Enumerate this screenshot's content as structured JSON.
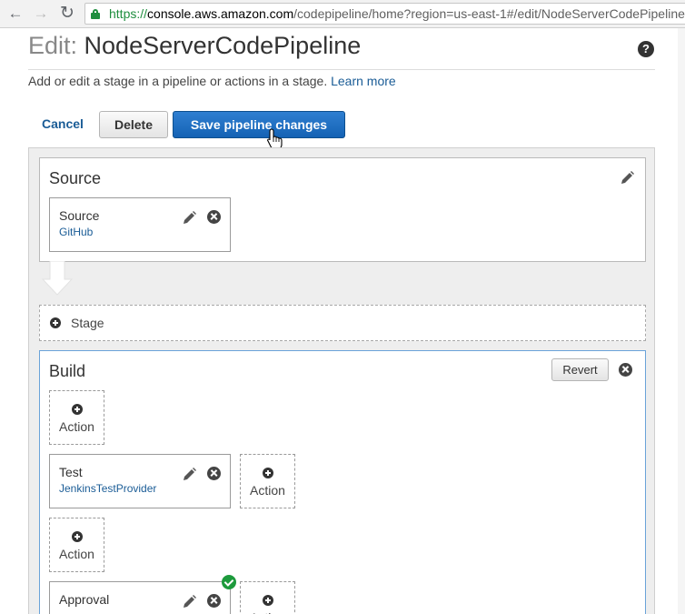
{
  "browser": {
    "url_protocol": "https://",
    "url_host": "console.aws.amazon.com",
    "url_path": "/codepipeline/home?region=us-east-1#/edit/NodeServerCodePipeline"
  },
  "header": {
    "title_prefix": "Edit:",
    "title_name": "NodeServerCodePipeline",
    "subtitle": "Add or edit a stage in a pipeline or actions in a stage.",
    "learn_more": "Learn more"
  },
  "toolbar": {
    "cancel_label": "Cancel",
    "delete_label": "Delete",
    "save_label": "Save pipeline changes"
  },
  "stages": {
    "source": {
      "name": "Source",
      "actions": [
        {
          "name": "Source",
          "provider": "GitHub"
        }
      ]
    },
    "add_stage_label": "Stage",
    "build": {
      "name": "Build",
      "revert_label": "Revert",
      "add_action_label": "Action",
      "actions": [
        {
          "name": "Test",
          "provider": "JenkinsTestProvider"
        },
        {
          "name": "Approval",
          "provider": ""
        }
      ]
    }
  },
  "colors": {
    "primary_button": "#1462b4",
    "link": "#1a5c96",
    "success": "#1d9a3c",
    "secure_url": "#1e8e3e"
  }
}
